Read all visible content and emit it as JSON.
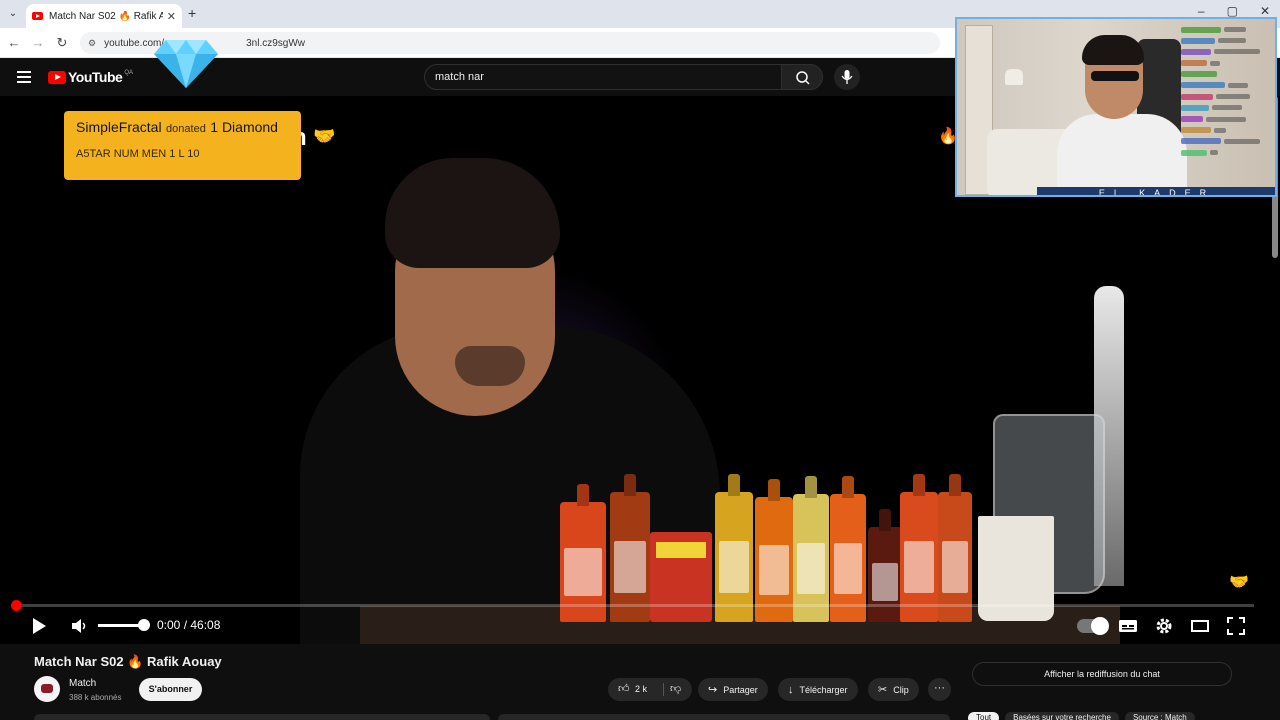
{
  "browser": {
    "tab_title": "Match Nar S02 🔥 Rafik Aouay",
    "url": "youtube.com/watch?v=Hmj3x8Nl.cz9sgWw",
    "url_visible_start": "youtube.com/",
    "url_visible_end": "3nl.cz9sgWw"
  },
  "youtube": {
    "logo_text": "YouTube",
    "country_code": "QA",
    "search_value": "match nar"
  },
  "donation": {
    "donor": "SimpleFractal",
    "verb": "donated",
    "amount": "1 Diamond",
    "message": "A5TAR NUM MEN 1 L 10",
    "color": "#f4b21f"
  },
  "player": {
    "time": "0:00 / 46:08",
    "progress_fraction": 0.0,
    "volume_fraction": 1.0
  },
  "webcam": {
    "streamer_name": "EL KADER",
    "border_color": "#6fb0e6"
  },
  "video_info": {
    "title": "Match Nar S02 🔥 Rafik Aouay",
    "channel_name": "Match",
    "subscribers": "388 k abonnés",
    "subscribe_label": "S'abonner",
    "like_count": "2 k",
    "share_label": "Partager",
    "download_label": "Télécharger",
    "clip_label": "Clip",
    "chat_replay_label": "Afficher la rediffusion du chat"
  },
  "chips": [
    {
      "label": "Tout",
      "active": true
    },
    {
      "label": "Basées sur votre recherche",
      "active": false
    },
    {
      "label": "Source : Match",
      "active": false
    }
  ],
  "colors": {
    "youtube_red": "#ff0000",
    "background": "#0f0f0f"
  }
}
